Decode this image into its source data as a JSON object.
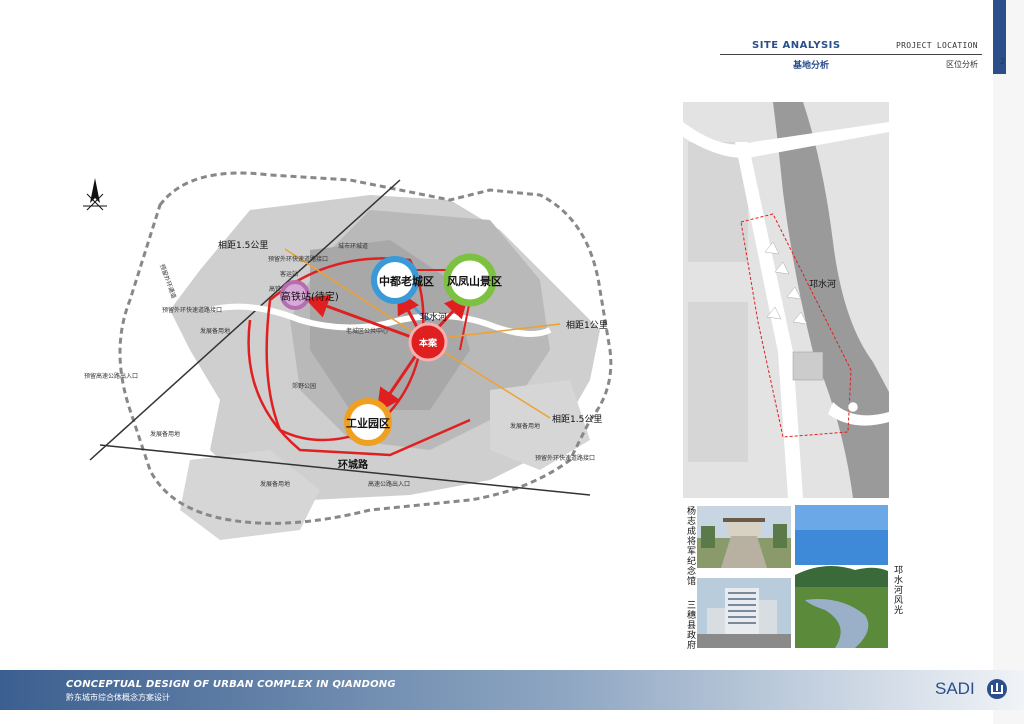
{
  "header": {
    "title_en": "SITE ANALYSIS",
    "subtitle_en": "PROJECT LOCATION",
    "title_cn": "基地分析",
    "subtitle_cn": "区位分析",
    "page_number": "2"
  },
  "footer": {
    "title_en": "CONCEPTUAL DESIGN OF URBAN COMPLEX IN QIANDONG",
    "title_cn": "黔东城市综合体概念方案设计",
    "logo_text": "SADI"
  },
  "map": {
    "distance_labels": [
      "相距1.5公里",
      "相距1公里",
      "相距1.5公里"
    ],
    "zones": [
      {
        "label": "高铁站(待定)",
        "color": "#b36fb0"
      },
      {
        "label": "中都老城区",
        "color": "#3a9ad8"
      },
      {
        "label": "风凤山景区",
        "color": "#7cc240"
      },
      {
        "label": "本案",
        "color": "#e02020"
      },
      {
        "label": "工业园区",
        "color": "#f0a020"
      }
    ],
    "place_labels": {
      "river": "邛水河",
      "ring_road": "环城路",
      "highway": "预留外环通道",
      "ring_city": "城市环城道",
      "bus_station": "客运站",
      "exit1": "预留外环快速道路接口",
      "exit2": "预留外环快速道路接口",
      "exit3": "预留外环快速道路接口",
      "exit4": "预留高速公路出入口",
      "exit5": "高速公路出入口",
      "reserve1": "发展备用地",
      "reserve2": "发展备用地",
      "reserve3": "发展备用地",
      "reserve4": "发展备用地",
      "park": "郊野公园",
      "expo": "高铁",
      "district": "老城区公共中心",
      "road": "预留外环通道"
    }
  },
  "site_plan": {
    "river_label": "邛水河"
  },
  "photos": [
    {
      "caption": "杨志成将军纪念馆"
    },
    {
      "caption": "邛水河风光"
    },
    {
      "caption": "三穗县政府"
    }
  ],
  "colors": {
    "brand": "#2a4f8a",
    "arrow": "#e02020",
    "distance_line": "#f0a030"
  }
}
